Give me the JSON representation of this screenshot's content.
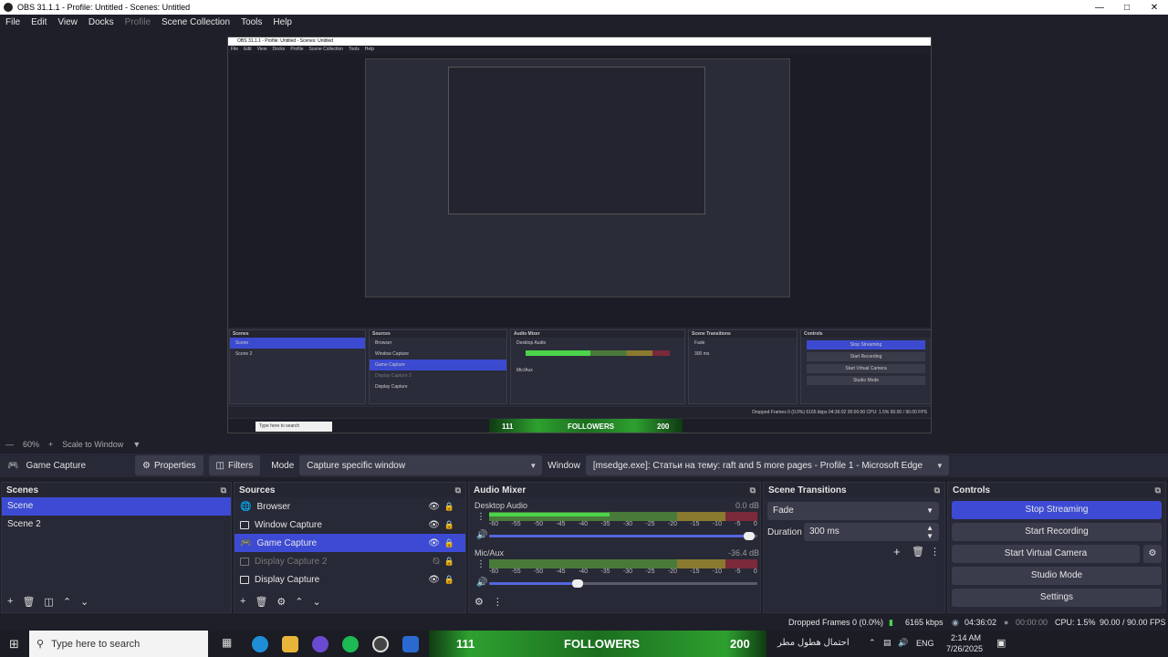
{
  "window": {
    "title": "OBS 31.1.1 - Profile: Untitled - Scenes: Untitled"
  },
  "menu": [
    "File",
    "Edit",
    "View",
    "Docks",
    "Profile",
    "Scene Collection",
    "Tools",
    "Help"
  ],
  "preview": {
    "zoom": "60%",
    "scale_label": "Scale to Window",
    "nested_title": "OBS 31.1.1 - Profile: Untitled - Scenes: Untitled",
    "nested_status": "Dropped Frames 0 (0.0%)  6165 kbps  04:36:02  00:00:00  CPU: 1.5%  90.00 / 90.00 FPS"
  },
  "context": {
    "source_name": "Game Capture",
    "properties_label": "Properties",
    "filters_label": "Filters",
    "mode_label": "Mode",
    "mode_value": "Capture specific window",
    "window_label": "Window",
    "window_value": "[msedge.exe]: Статьи на тему: raft and 5 more pages - Profile 1 - Microsoft Edge"
  },
  "scenes": {
    "title": "Scenes",
    "items": [
      "Scene",
      "Scene 2"
    ],
    "selected": 0
  },
  "sources": {
    "title": "Sources",
    "items": [
      "Browser",
      "Window Capture",
      "Game Capture",
      "Display Capture 2",
      "Display Capture"
    ]
  },
  "audio": {
    "title": "Audio Mixer",
    "channels": [
      {
        "name": "Desktop Audio",
        "db": "0.0 dB",
        "level": 0.45,
        "volume": 0.97
      },
      {
        "name": "Mic/Aux",
        "db": "-36.4 dB",
        "level": 0.0,
        "volume": 0.33
      }
    ],
    "ticks": [
      "-60",
      "-55",
      "-50",
      "-45",
      "-40",
      "-35",
      "-30",
      "-25",
      "-20",
      "-15",
      "-10",
      "-5",
      "0"
    ]
  },
  "transitions": {
    "title": "Scene Transitions",
    "value": "Fade",
    "duration_label": "Duration",
    "duration_value": "300 ms"
  },
  "controls": {
    "title": "Controls",
    "buttons": [
      "Stop Streaming",
      "Start Recording",
      "Start Virtual Camera",
      "Studio Mode",
      "Settings"
    ]
  },
  "status": {
    "dropped": "Dropped Frames 0 (0.0%)",
    "bitrate": "6165 kbps",
    "stream_time": "04:36:02",
    "rec_time": "00:00:00",
    "cpu": "CPU: 1.5%",
    "fps": "90.00 / 90.00 FPS"
  },
  "taskbar": {
    "search_placeholder": "Type here to search",
    "banner_left": "111",
    "banner_mid": "FOLLOWERS",
    "banner_right": "200",
    "weather": "احتمال هطول مطر",
    "lang": "ENG",
    "time": "2:14 AM",
    "date": "7/26/2025"
  }
}
